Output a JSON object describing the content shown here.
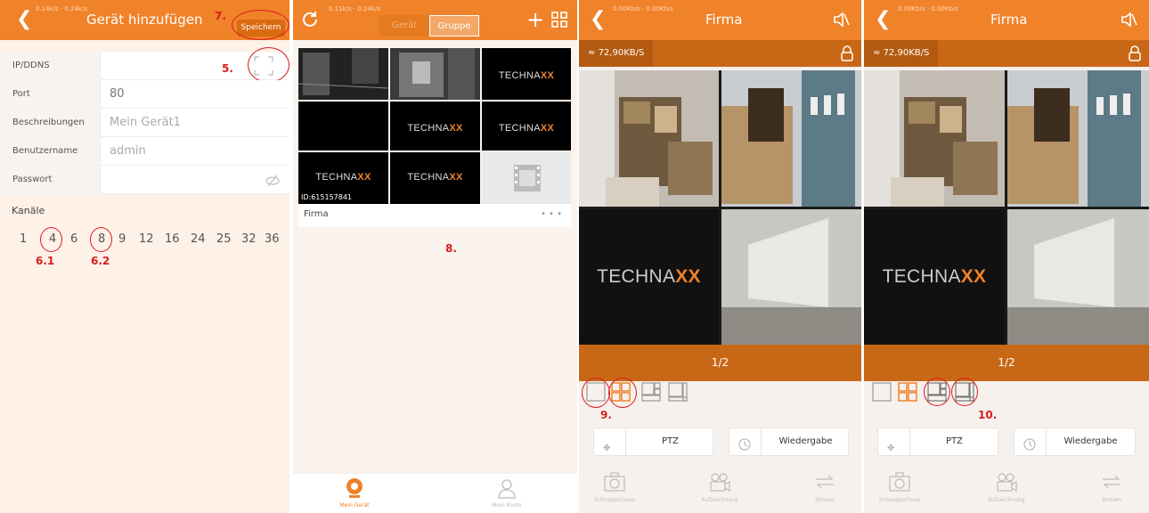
{
  "p1": {
    "status": "0.14k/s · 0.24k/s",
    "title": "Gerät hinzufügen",
    "save": "Speichern",
    "fields": [
      {
        "label": "IP/DDNS",
        "value": ""
      },
      {
        "label": "Port",
        "value": "80"
      },
      {
        "label": "Beschreibungen",
        "value": "Mein Gerät1"
      },
      {
        "label": "Benutzername",
        "value": "admin"
      },
      {
        "label": "Passwort",
        "value": ""
      }
    ],
    "channels_label": "Kanäle",
    "channels": [
      "1",
      "4",
      "6",
      "8",
      "9",
      "12",
      "16",
      "24",
      "25",
      "32",
      "36"
    ],
    "callouts": {
      "c5": "5.",
      "c61": "6.1",
      "c62": "6.2",
      "c7": "7."
    }
  },
  "p2": {
    "status": "0.11k/s · 0.24k/s",
    "tab_device": "Gerät",
    "tab_group": "Gruppe",
    "brand_a": "TECHNA",
    "brand_b": "XX",
    "device_id": "ID:615157841",
    "device_name": "Firma",
    "more": "• • •",
    "callout": "8.",
    "tabs": [
      "Mein Gerät",
      "Mein Konto"
    ]
  },
  "p3": {
    "status": "0.00Kb/s · 0.00Kb/s",
    "title": "Firma",
    "speed": "72,90KB/S",
    "page": "1/2",
    "brand_a": "TECHNA",
    "brand_b": "XX",
    "ptz": "PTZ",
    "playback": "Wiedergabe",
    "callout": "9.",
    "tabs": [
      "Schnappschuss",
      "Aufzeichnung",
      "Stream"
    ]
  },
  "p4": {
    "status": "0.00Kb/s · 0.00Kb/s",
    "title": "Firma",
    "speed": "72,90KB/S",
    "page": "1/2",
    "brand_a": "TECHNA",
    "brand_b": "XX",
    "ptz": "PTZ",
    "playback": "Wiedergabe",
    "callout": "10.",
    "tabs": [
      "Schnappschuss",
      "Aufzeichnung",
      "Stream"
    ]
  },
  "colors": {
    "orange": "#f0822a",
    "dark_orange": "#c86817",
    "callout_red": "#d81e1e"
  }
}
